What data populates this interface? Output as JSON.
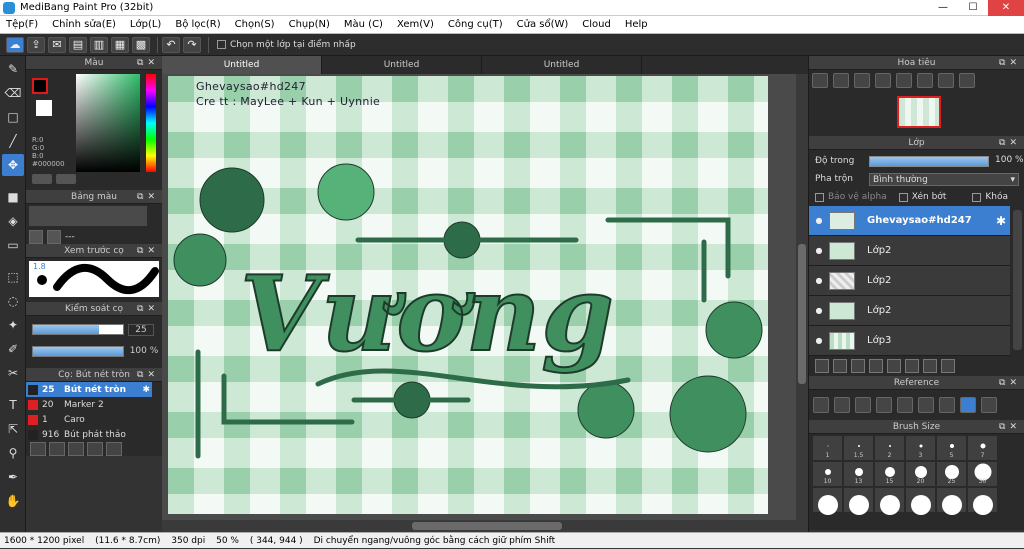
{
  "app": {
    "title": "MediBang Paint Pro (32bit)"
  },
  "menu": [
    "Tệp(F)",
    "Chỉnh sửa(E)",
    "Lớp(L)",
    "Bộ lọc(R)",
    "Chọn(S)",
    "Chụp(N)",
    "Màu (C)",
    "Xem(V)",
    "Công cụ(T)",
    "Cửa sổ(W)",
    "Cloud",
    "Help"
  ],
  "toolbar": {
    "select_layer_label": "Chọn một lớp tại điểm nhấp"
  },
  "left_panel": {
    "color_title": "Màu",
    "color_values": {
      "r": "R:0",
      "g": "G:0",
      "b": "B:0",
      "hex": "#000000"
    },
    "palette_title": "Bảng màu",
    "palette_dash": "---",
    "preview_title": "Xem trước cọ",
    "brush_size_label": "1.8 ",
    "control_title": "Kiểm soát cọ",
    "control_size": "25",
    "control_opacity": "100 %",
    "brush_title": "Cọ: Bút nét tròn",
    "brushes": [
      {
        "size": "25",
        "name": "Bút nét tròn",
        "color": "#222222"
      },
      {
        "size": "20",
        "name": "Marker 2",
        "color": "#e02020"
      },
      {
        "size": "1",
        "name": "Caro",
        "color": "#e02020"
      },
      {
        "size": "916",
        "name": "Bút phát thảo",
        "color": "#222222"
      }
    ]
  },
  "tabs": [
    "Untitled",
    "Untitled",
    "Untitled"
  ],
  "canvas": {
    "credit_line1": "Ghevaysao#hd247",
    "credit_line2": "Cre tt : MayLee + Kun + Uynnie",
    "art_word": "Vương"
  },
  "right_panel": {
    "navigator_title": "Hoa tiêu",
    "layer_title": "Lớp",
    "opacity_label": "Độ trong",
    "opacity_value": "100 %",
    "blend_label": "Pha trộn",
    "blend_value": "Bình thường",
    "protect_alpha": "Bảo vệ alpha",
    "clipping": "Xén bớt",
    "lock": "Khóa",
    "layers": [
      {
        "name": "Ghevaysao#hd247",
        "selected": true
      },
      {
        "name": "Lớp2",
        "selected": false
      },
      {
        "name": "Lớp2",
        "selected": false
      },
      {
        "name": "Lớp2",
        "selected": false
      },
      {
        "name": "Lớp3",
        "selected": false
      }
    ],
    "reference_title": "Reference",
    "brush_size_title": "Brush Size",
    "brush_sizes": [
      "1",
      "1.5",
      "2",
      "3",
      "5",
      "7",
      "10",
      "13",
      "15",
      "20",
      "25",
      "30",
      "",
      "",
      "",
      "",
      "",
      ""
    ]
  },
  "status": {
    "size": "1600 * 1200 pixel",
    "cm": "(11.6 * 8.7cm)",
    "dpi": "350 dpi",
    "zoom": "50 %",
    "coord": "( 344, 944 )",
    "hint": "Di chuyển ngang/vuông góc bằng cách giữ phím Shift"
  },
  "colors": {
    "accent": "#3c7fd0",
    "art_dark": "#2e6b48",
    "art_mid": "#3f8f5f",
    "art_light": "#57b27a"
  }
}
